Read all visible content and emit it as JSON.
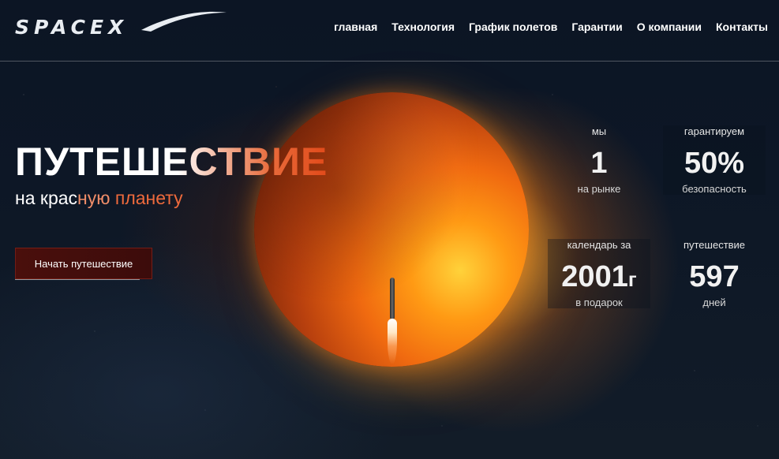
{
  "header": {
    "logo_text": "SPACEX",
    "nav": [
      "главная",
      "Технология",
      "График полетов",
      "Гарантии",
      "О компании",
      "Контакты"
    ]
  },
  "hero": {
    "title": "ПУТЕШЕСТВИЕ",
    "subtitle_part1": "на крас",
    "subtitle_part2": "ную ",
    "subtitle_part3": "планету",
    "cta_label": "Начать путешествие"
  },
  "stats": [
    {
      "label": "мы",
      "value": "1",
      "suffix": "",
      "sub": "на рынке"
    },
    {
      "label": "гарантируем",
      "value": "50%",
      "suffix": "",
      "sub": "безопасность"
    },
    {
      "label": "календарь за",
      "value": "2001",
      "suffix": "г",
      "sub": "в подарок"
    },
    {
      "label": "путешествие",
      "value": "597",
      "suffix": "",
      "sub": "дней"
    }
  ],
  "colors": {
    "accent_red": "#e24a1a",
    "cta_bg": "#4a0f0c",
    "background": "#0c1524"
  },
  "icons": [
    "spacex-logo",
    "planet-image",
    "rocket-image"
  ]
}
